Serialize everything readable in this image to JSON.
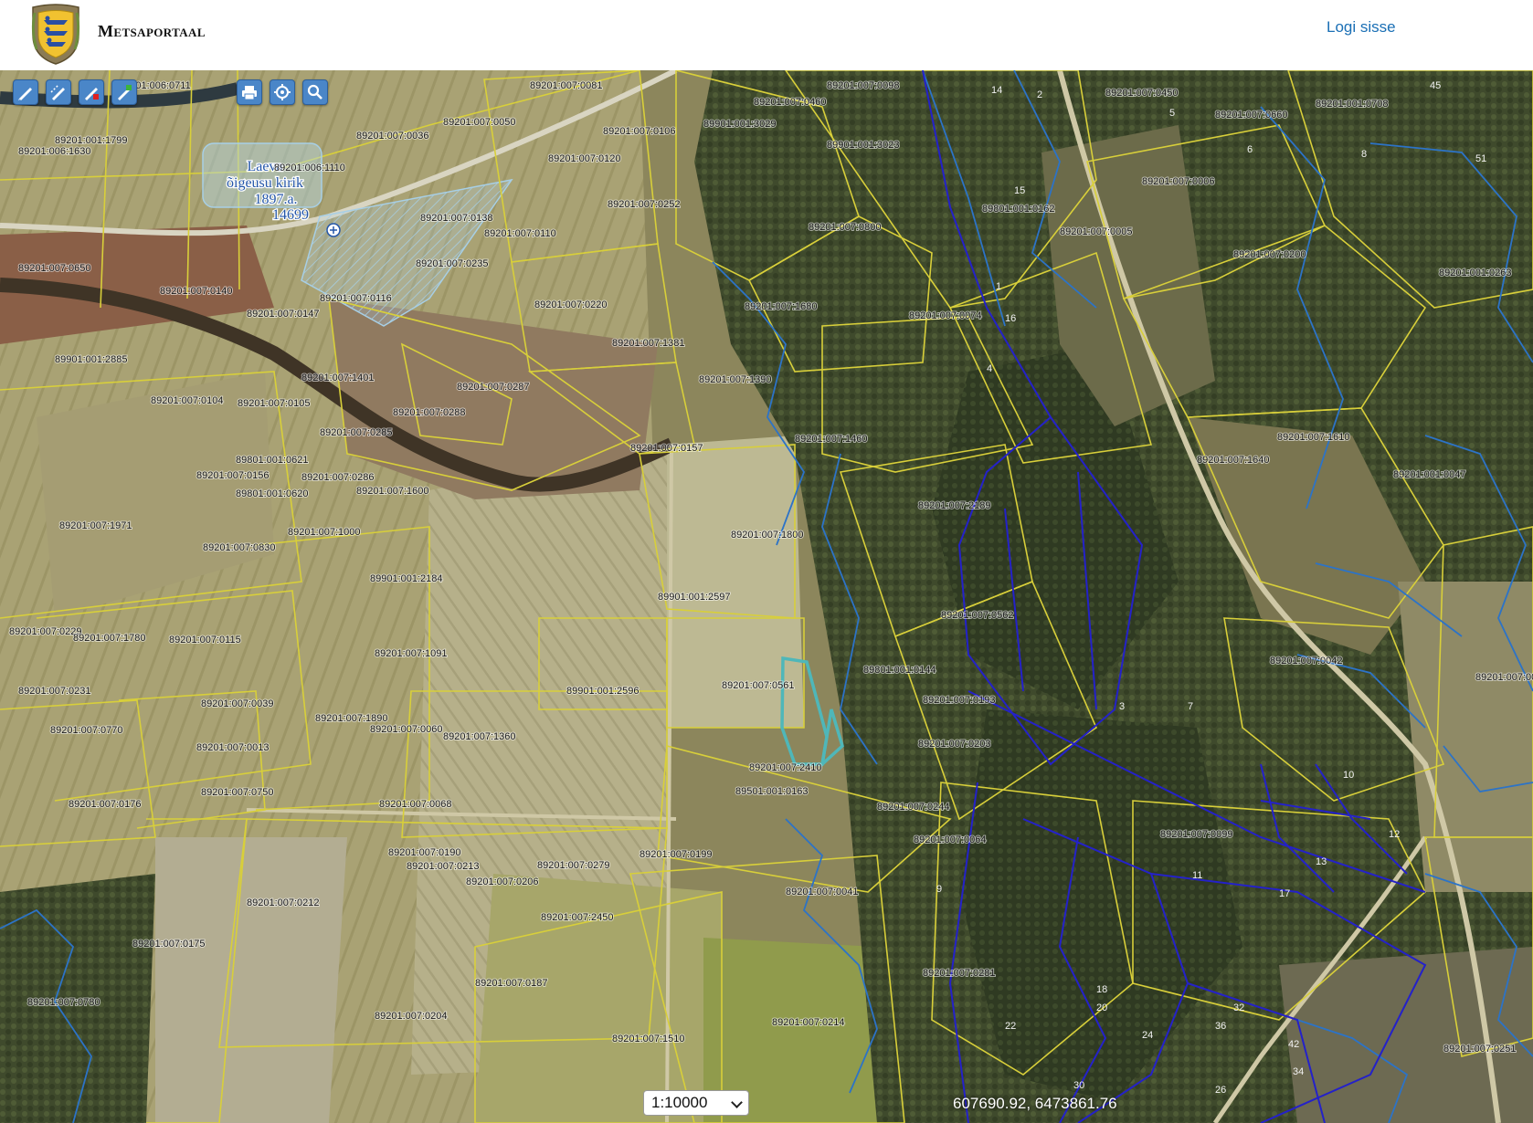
{
  "header": {
    "brand_cap": "M",
    "brand_rest": "etsaportaal",
    "login_label": "Logi sisse"
  },
  "toolbar": {
    "draw_line": "pencil-icon",
    "draw_area": "measure-icon",
    "erase": "eraser-icon",
    "draw_polygon": "polygon-icon",
    "print": "print-icon",
    "locate": "locate-icon",
    "search": "search-icon"
  },
  "map": {
    "scale": "1:10000",
    "coordinates": "607690.92, 6473861.76",
    "poi_label": {
      "line1": "Laeva",
      "line2": "õigeusu kirik",
      "line3": "1897.a.",
      "line4": "14699"
    },
    "parcels": [
      "89201:006:0711",
      "89201:007:0081",
      "89201:007:0460",
      "89201:007:0098",
      "89201:007:0450",
      "89201:001:0708",
      "89201:001:1799",
      "89201:007:0036",
      "89201:007:0050",
      "89201:007:0106",
      "89901:001:3029",
      "89901:001:3023",
      "89201:007:0660",
      "89201:006:1630",
      "89201:007:0120",
      "89201:006:1110",
      "89201:007:0252",
      "89201:007:0006",
      "89801:001:0162",
      "89201:007:0138",
      "89201:007:0110",
      "89201:007:0800",
      "89201:007:0005",
      "89201:007:0200",
      "89201:001:0263",
      "89201:007:0650",
      "89201:007:0140",
      "89201:007:0235",
      "89201:007:0116",
      "89201:007:0147",
      "89201:007:0220",
      "89201:007:1680",
      "89201:007:0074",
      "89201:007:1381",
      "89901:001:2885",
      "89201:007:1401",
      "89201:007:0287",
      "89201:007:1390",
      "89201:007:0104",
      "89201:007:0105",
      "89201:007:0288",
      "89201:007:1460",
      "89201:007:1610",
      "89201:007:0285",
      "89801:001:0621",
      "89201:007:0157",
      "89201:007:1640",
      "89201:007:0156",
      "89201:007:0286",
      "89201:007:1600",
      "89201:001:0047",
      "89801:001:0620",
      "89201:007:2189",
      "89201:007:1971",
      "89201:007:1000",
      "89201:007:1800",
      "89201:007:0830",
      "89901:001:2184",
      "89901:001:2597",
      "89201:007:0562",
      "89201:007:0229",
      "89201:007:1780",
      "89201:007:0115",
      "89201:007:1091",
      "89801:001:0144",
      "89201:007:0042",
      "89201:007:0231",
      "89201:007:0039",
      "89901:001:2596",
      "89201:007:0561",
      "89201:007:0193",
      "89201:007:0007",
      "89201:007:1890",
      "89201:007:0060",
      "89201:007:1360",
      "89201:007:0770",
      "89201:007:0013",
      "89201:007:0203",
      "89201:007:2410",
      "89501:001:0163",
      "89201:007:0750",
      "89201:007:0244",
      "89201:007:0176",
      "89201:007:0068",
      "89201:007:0099",
      "89201:007:0064",
      "89201:007:0199",
      "89201:007:0190",
      "89201:007:0213",
      "89201:007:0279",
      "89201:007:0206",
      "89201:007:0041",
      "89201:007:0212",
      "89201:007:2450",
      "89201:007:0175",
      "89201:007:0780",
      "89201:007:0281",
      "89201:007:0187",
      "89201:007:0204",
      "89201:007:0214",
      "89201:007:1510",
      "89201:007:0251"
    ],
    "stands": [
      "14",
      "2",
      "5",
      "6",
      "8",
      "15",
      "16",
      "1",
      "4",
      "3",
      "7",
      "9",
      "10",
      "12",
      "11",
      "13",
      "17",
      "18",
      "20",
      "22",
      "24",
      "26",
      "30",
      "32",
      "34",
      "36",
      "42",
      "45",
      "51"
    ]
  }
}
